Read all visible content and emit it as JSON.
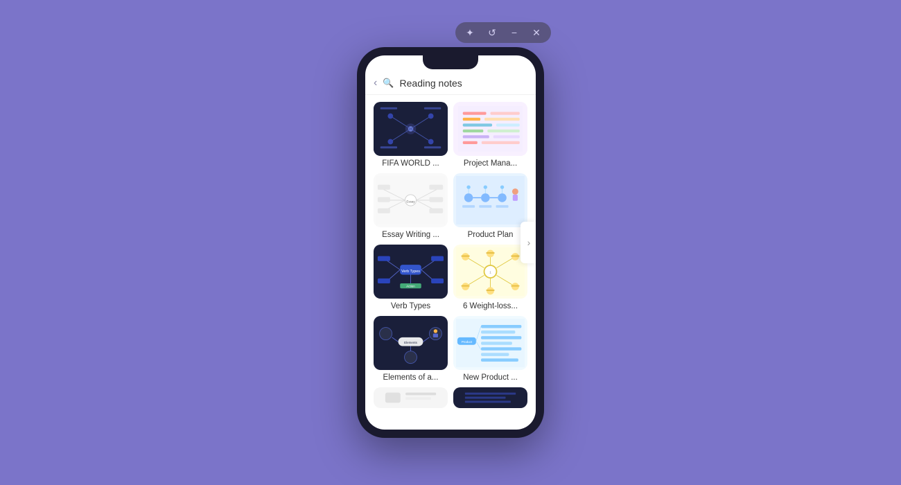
{
  "background_color": "#7b74c9",
  "titlebar": {
    "buttons": [
      {
        "name": "star-icon",
        "symbol": "✦"
      },
      {
        "name": "history-icon",
        "symbol": "↺"
      },
      {
        "name": "minimize-icon",
        "symbol": "−"
      },
      {
        "name": "close-icon",
        "symbol": "✕"
      }
    ]
  },
  "phone": {
    "search": {
      "placeholder": "Reading notes"
    },
    "grid": [
      {
        "id": "fifa",
        "label": "FIFA WORLD ...",
        "theme": "dark"
      },
      {
        "id": "project-mgmt",
        "label": "Project Mana...",
        "theme": "light-purple"
      },
      {
        "id": "essay",
        "label": "Essay Writing ...",
        "theme": "light"
      },
      {
        "id": "product-plan",
        "label": "Product Plan",
        "theme": "light-blue"
      },
      {
        "id": "verb-types",
        "label": "Verb Types",
        "theme": "dark"
      },
      {
        "id": "weight-loss",
        "label": "6 Weight-loss...",
        "theme": "light-yellow"
      },
      {
        "id": "elements",
        "label": "Elements of a...",
        "theme": "dark"
      },
      {
        "id": "new-product",
        "label": "New Product ...",
        "theme": "light-blue"
      },
      {
        "id": "partial-left",
        "label": "",
        "theme": "light"
      },
      {
        "id": "partial-right",
        "label": "",
        "theme": "dark"
      }
    ],
    "scroll_arrow": "›"
  }
}
